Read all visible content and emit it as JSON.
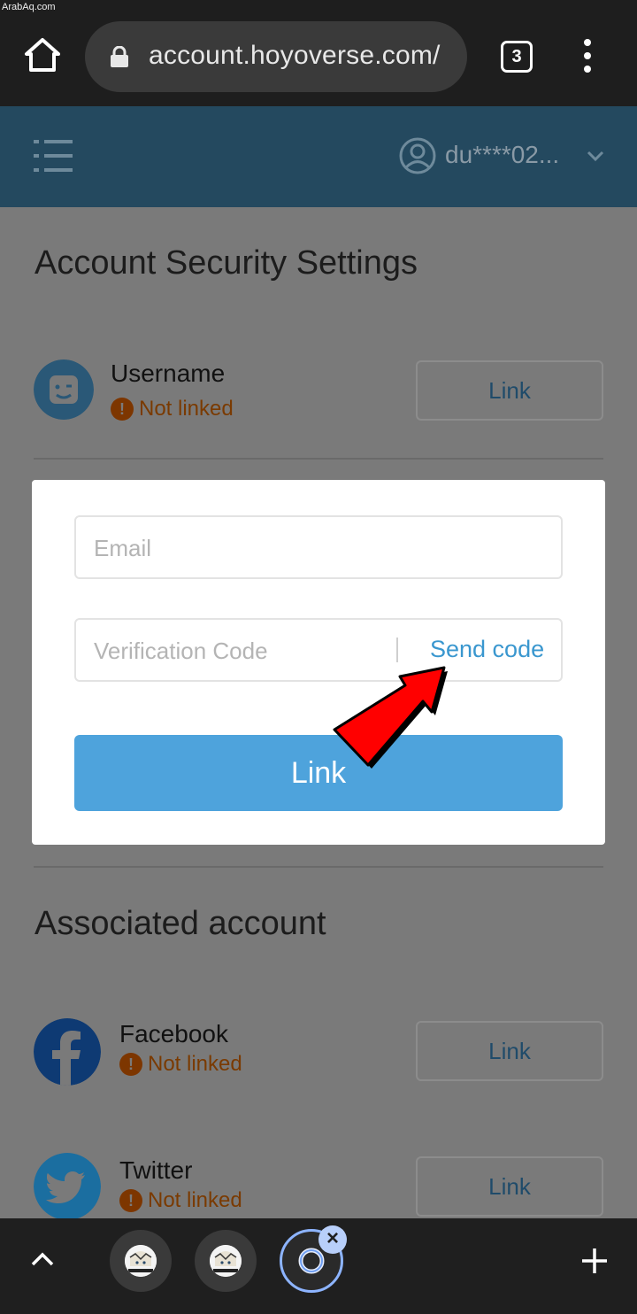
{
  "watermark": "ArabAq.com",
  "browser": {
    "url": "account.hoyoverse.com/",
    "tab_count": "3"
  },
  "header": {
    "username": "du****02..."
  },
  "page": {
    "title": "Account Security Settings",
    "username_row": {
      "label": "Username",
      "status": "Not linked",
      "button": "Link"
    },
    "associated_title": "Associated account",
    "accounts": [
      {
        "label": "Facebook",
        "status": "Not linked",
        "button": "Link",
        "color": "#0e3a73"
      },
      {
        "label": "Twitter",
        "status": "Not linked",
        "button": "Link",
        "color": "#1b6ea0"
      }
    ]
  },
  "modal": {
    "email_placeholder": "Email",
    "code_placeholder": "Verification Code",
    "send_code": "Send code",
    "submit": "Link"
  },
  "colors": {
    "header": "#24495f",
    "primary": "#4ea3dc",
    "send_code": "#3a97cf",
    "warning": "#7d3600"
  },
  "icons": [
    "home-icon",
    "lock-icon",
    "kebab-menu-icon",
    "hamburger-icon",
    "account-avatar-icon",
    "chevron-down-icon",
    "face-icon",
    "warning-icon",
    "facebook-icon",
    "twitter-icon",
    "arrow-annotation",
    "chevron-up-icon",
    "close-icon",
    "plus-icon"
  ]
}
